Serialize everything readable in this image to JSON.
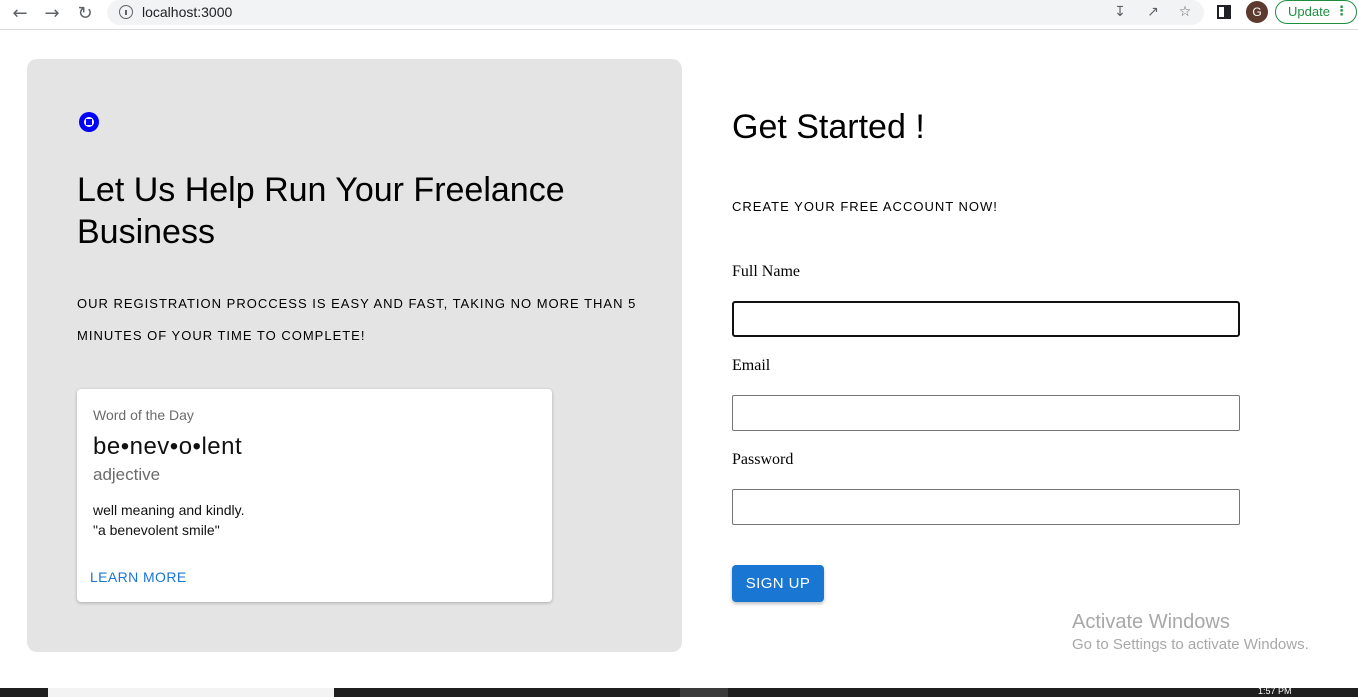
{
  "browser": {
    "url": "localhost:3000",
    "back_icon": "arrow-left-icon",
    "forward_icon": "arrow-right-icon",
    "reload_icon": "reload-icon",
    "avatar_initial": "G",
    "update_label": "Update"
  },
  "left": {
    "title": "Let Us Help Run Your Freelance Business",
    "subtitle": "OUR REGISTRATION PROCCESS IS EASY AND FAST, TAKING NO MORE THAN 5 MINUTES OF YOUR TIME TO COMPLETE!",
    "word_card": {
      "eyebrow": "Word of the Day",
      "word": "be•nev•o•lent",
      "part_of_speech": "adjective",
      "definition": "well meaning and kindly.",
      "example": "\"a benevolent smile\"",
      "learn_more": "LEARN MORE"
    }
  },
  "form": {
    "title": "Get Started !",
    "subtitle": "CREATE YOUR FREE ACCOUNT NOW!",
    "full_name_label": "Full Name",
    "full_name_value": "",
    "email_label": "Email",
    "email_value": "",
    "password_label": "Password",
    "password_value": "",
    "submit_label": "SIGN UP"
  },
  "watermark": {
    "title": "Activate Windows",
    "subtitle": "Go to Settings to activate Windows."
  },
  "taskbar": {
    "clock": "1:57 PM"
  },
  "colors": {
    "accent": "#1976d2",
    "panel_bg": "#e4e4e4",
    "logo": "#0000ff",
    "update_green": "#1e8e3e"
  }
}
